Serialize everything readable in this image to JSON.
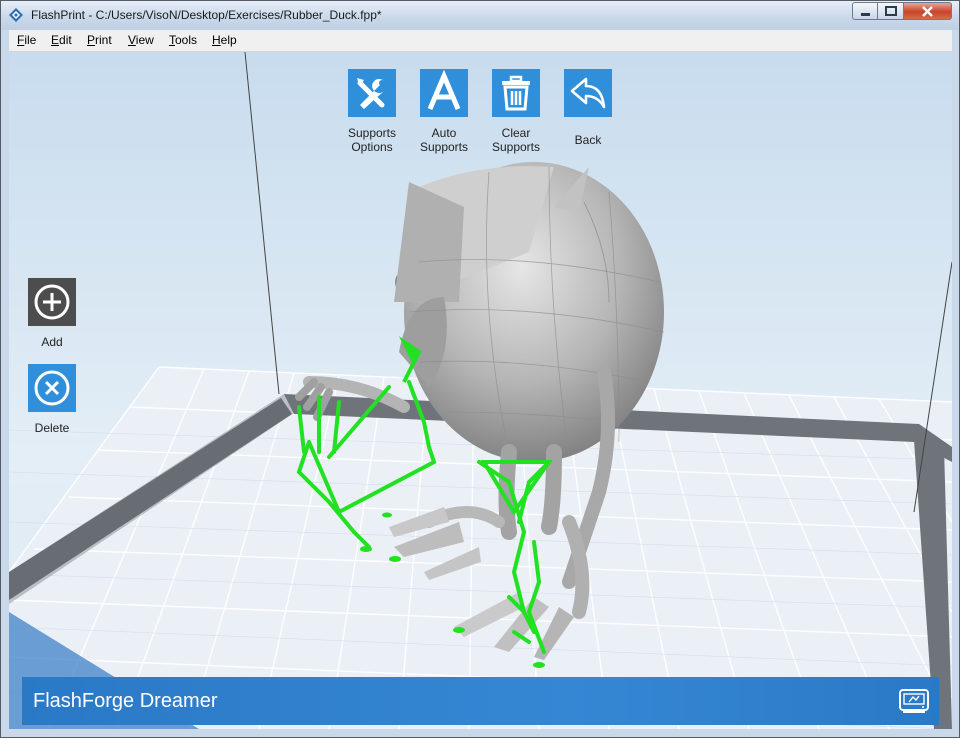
{
  "window": {
    "title": "FlashPrint - C:/Users/VisoN/Desktop/Exercises/Rubber_Duck.fpp*"
  },
  "menu": [
    {
      "key": "F",
      "rest": "ile"
    },
    {
      "key": "E",
      "rest": "dit"
    },
    {
      "key": "P",
      "rest": "rint"
    },
    {
      "key": "V",
      "rest": "iew"
    },
    {
      "key": "T",
      "rest": "ools"
    },
    {
      "key": "H",
      "rest": "elp"
    }
  ],
  "toolbar": {
    "supports_options": {
      "line1": "Supports",
      "line2": "Options",
      "icon": "tools-icon"
    },
    "auto_supports": {
      "line1": "Auto",
      "line2": "Supports",
      "icon": "letter-a-icon"
    },
    "clear_supports": {
      "line1": "Clear",
      "line2": "Supports",
      "icon": "trash-icon"
    },
    "back": {
      "label": "Back",
      "icon": "undo-arrow-icon"
    }
  },
  "side": {
    "add": {
      "label": "Add",
      "icon": "plus-circle-icon"
    },
    "delete": {
      "label": "Delete",
      "icon": "x-circle-icon"
    }
  },
  "printer": {
    "name": "FlashForge Dreamer",
    "icon": "printer-settings-icon"
  },
  "colors": {
    "accent": "#2f8fdb",
    "support": "#22e022",
    "model": "#a9a9a9",
    "add_button_bg": "#4d4d4d",
    "printer_bar": "#2f80cc"
  }
}
